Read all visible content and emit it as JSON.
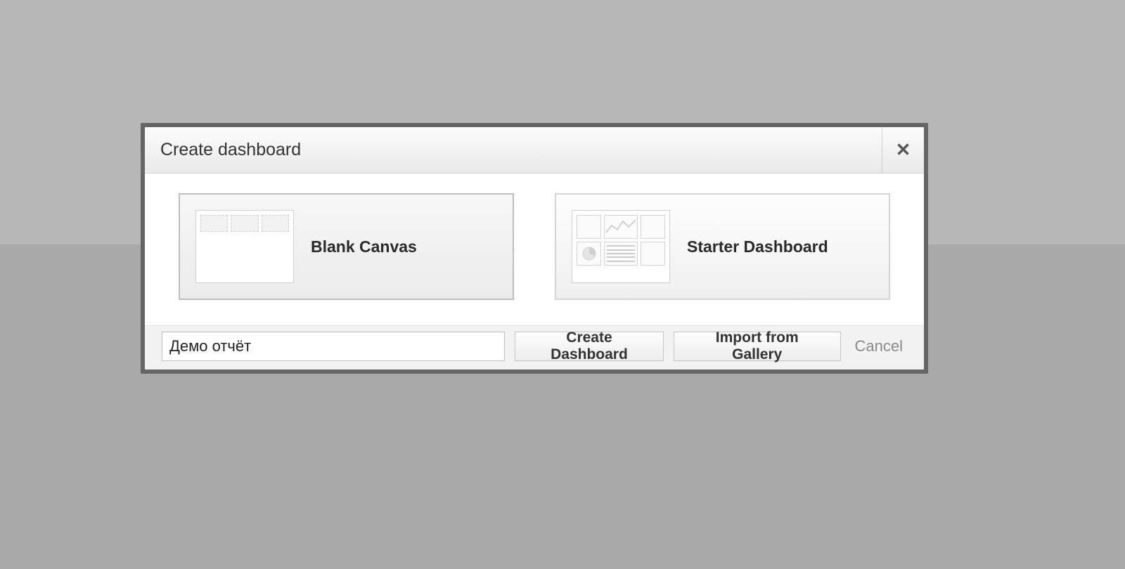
{
  "dialog": {
    "title": "Create dashboard",
    "close_label": "✕"
  },
  "options": {
    "blank": {
      "label": "Blank Canvas"
    },
    "starter": {
      "label": "Starter Dashboard"
    }
  },
  "footer": {
    "name_value": "Демо отчёт",
    "create_label": "Create Dashboard",
    "import_label": "Import from Gallery",
    "cancel_label": "Cancel"
  }
}
